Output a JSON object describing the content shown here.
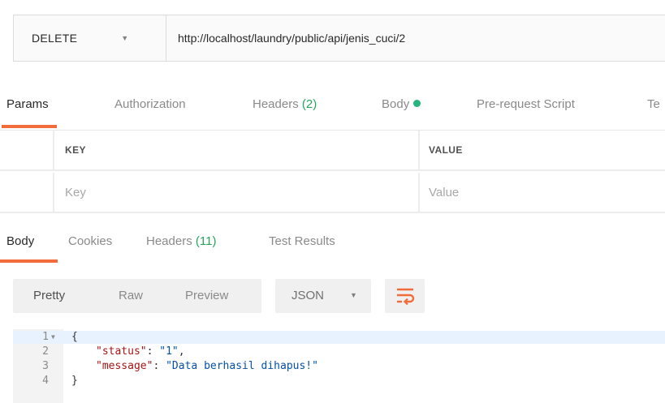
{
  "request": {
    "method": "DELETE",
    "url": "http://localhost/laundry/public/api/jenis_cuci/2"
  },
  "request_tabs": [
    {
      "label": "Params",
      "active": true
    },
    {
      "label": "Authorization"
    },
    {
      "label": "Headers ",
      "count": "(2)"
    },
    {
      "label": "Body"
    },
    {
      "label": "Pre-request Script"
    },
    {
      "label": "Te"
    }
  ],
  "params_table": {
    "headers": {
      "key": "KEY",
      "value": "VALUE"
    },
    "placeholders": {
      "key": "Key",
      "value": "Value"
    }
  },
  "response_tabs": [
    {
      "label": "Body",
      "active": true
    },
    {
      "label": "Cookies"
    },
    {
      "label": "Headers ",
      "count": "(11)"
    },
    {
      "label": "Test Results"
    }
  ],
  "response_toolbar": {
    "views": [
      "Pretty",
      "Raw",
      "Preview"
    ],
    "active_view": "Pretty",
    "format": "JSON"
  },
  "response_body": {
    "line_numbers": [
      "1",
      "2",
      "3",
      "4"
    ],
    "open_brace": "{",
    "close_brace": "}",
    "key_status": "\"status\"",
    "value_status": "\"1\"",
    "key_message": "\"message\"",
    "value_message": "\"Data berhasil dihapus!\""
  },
  "colors": {
    "accent": "#f26b3a",
    "count_green": "#26a65b",
    "body_dot": "#26b47d"
  }
}
